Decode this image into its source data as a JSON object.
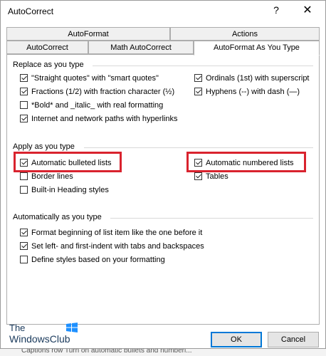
{
  "window": {
    "title": "AutoCorrect",
    "help": "?",
    "close": "✕"
  },
  "tabs": {
    "row1": [
      "AutoFormat",
      "Actions"
    ],
    "row2": [
      "AutoCorrect",
      "Math AutoCorrect",
      "AutoFormat As You Type"
    ],
    "active": "AutoFormat As You Type"
  },
  "replace": {
    "heading": "Replace as you type",
    "left": [
      {
        "label": "\"Straight quotes\" with \"smart quotes\"",
        "checked": true
      },
      {
        "label": "Fractions (1/2) with fraction character (½)",
        "checked": true
      },
      {
        "label": "*Bold* and _italic_ with real formatting",
        "checked": false
      },
      {
        "label": "Internet and network paths with hyperlinks",
        "checked": true
      }
    ],
    "right": [
      {
        "label": "Ordinals (1st) with superscript",
        "checked": true
      },
      {
        "label": "Hyphens (--) with dash (—)",
        "checked": true
      }
    ]
  },
  "apply": {
    "heading": "Apply as you type",
    "left": [
      {
        "label": "Automatic bulleted lists",
        "checked": true
      },
      {
        "label": "Border lines",
        "checked": false
      },
      {
        "label": "Built-in Heading styles",
        "checked": false
      }
    ],
    "right": [
      {
        "label": "Automatic numbered lists",
        "checked": true
      },
      {
        "label": "Tables",
        "checked": true
      }
    ]
  },
  "auto": {
    "heading": "Automatically as you type",
    "items": [
      {
        "label": "Format beginning of list item like the one before it",
        "checked": true
      },
      {
        "label": "Set left- and first-indent with tabs and backspaces",
        "checked": true
      },
      {
        "label": "Define styles based on your formatting",
        "checked": false
      }
    ]
  },
  "buttons": {
    "ok": "OK",
    "cancel": "Cancel"
  },
  "logo": {
    "the": "The",
    "main": "WindowsClub"
  },
  "bottom_strip": "Captions row   Turn on automatic bullets and numberi...",
  "colors": {
    "highlight": "#d9232e",
    "ok_border": "#0078d7"
  }
}
